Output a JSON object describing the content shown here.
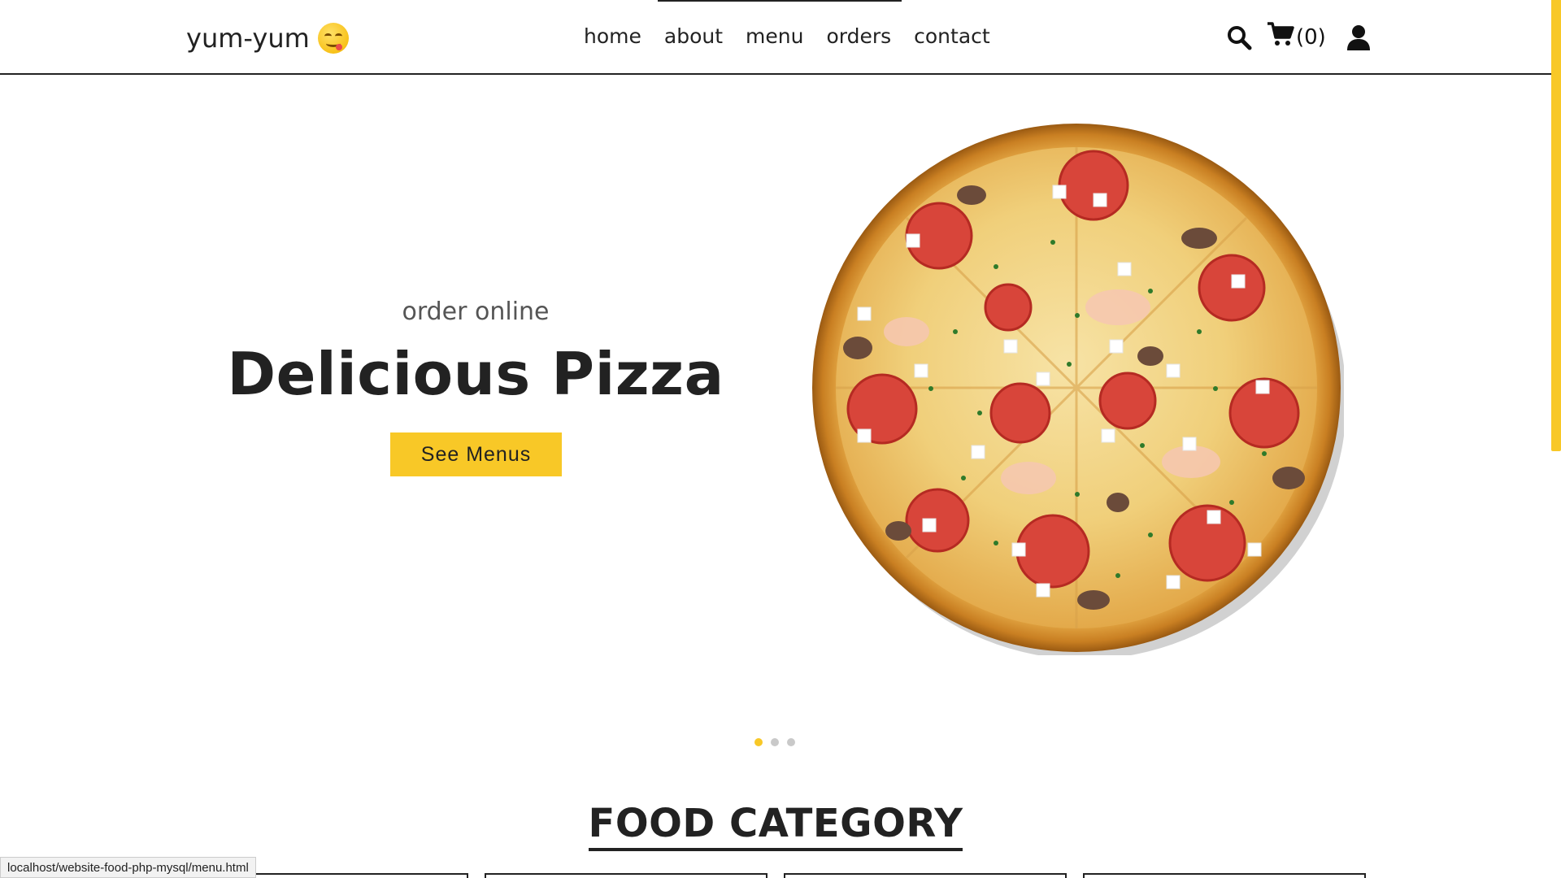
{
  "header": {
    "logo_text": "yum-yum",
    "logo_icon": "smiling-emoji-icon",
    "nav": [
      {
        "label": "home"
      },
      {
        "label": "about"
      },
      {
        "label": "menu"
      },
      {
        "label": "orders"
      },
      {
        "label": "contact"
      }
    ],
    "cart_count": "(0)",
    "icons": [
      "search-icon",
      "cart-icon",
      "user-icon"
    ]
  },
  "hero": {
    "subtitle": "order online",
    "title": "Delicious Pizza",
    "button_label": "See Menus",
    "slider_dots": 3,
    "active_dot": 1
  },
  "section": {
    "title": "FOOD CATEGORY"
  },
  "status_bar": {
    "url": "localhost/website-food-php-mysql/menu.html"
  },
  "colors": {
    "accent": "#f8c827",
    "text": "#222222",
    "dot_inactive": "#c9c9c9"
  }
}
